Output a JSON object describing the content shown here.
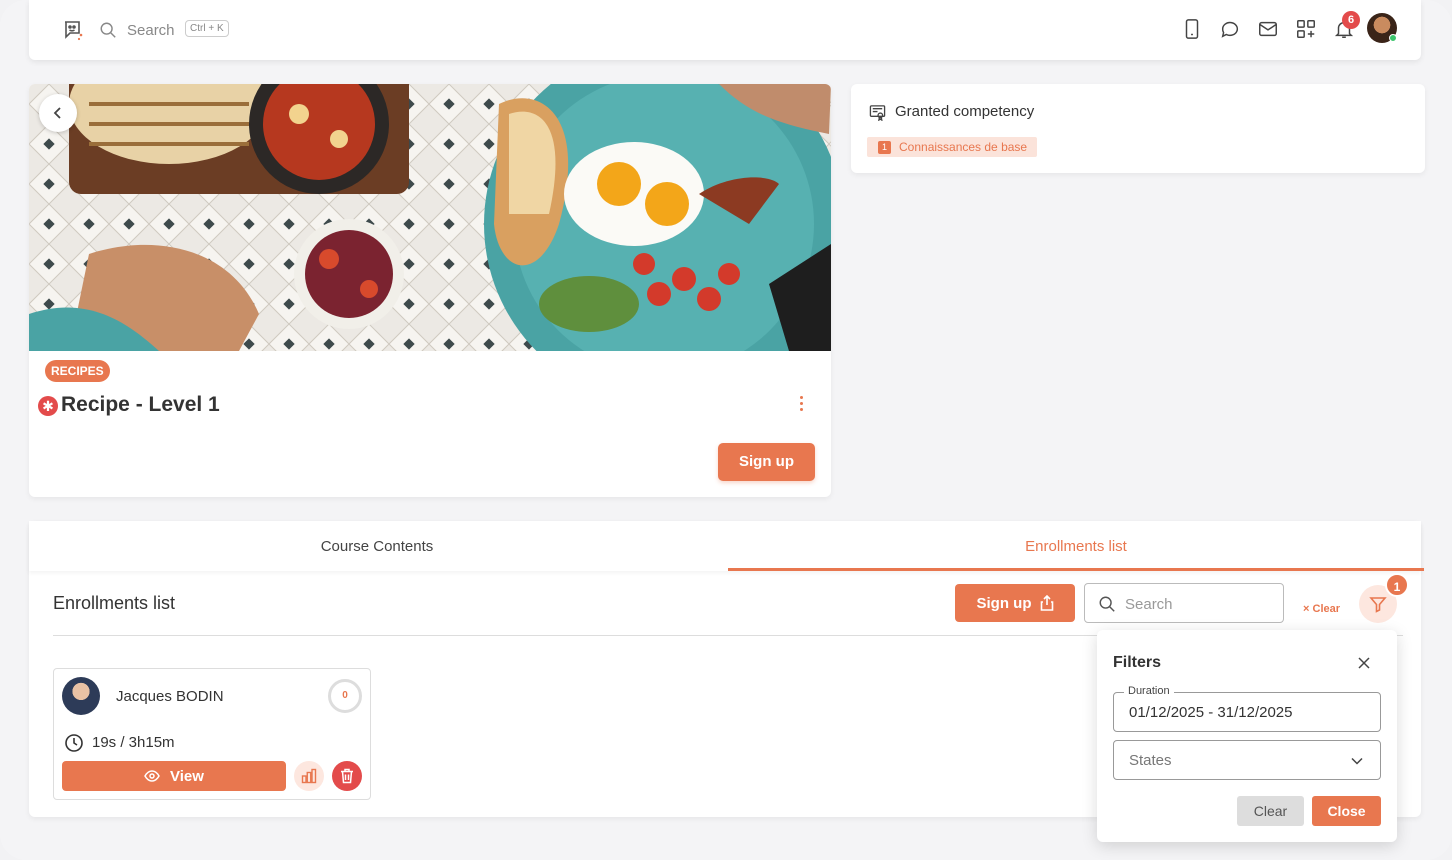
{
  "topbar": {
    "search_placeholder": "Search",
    "shortcut": "Ctrl + K",
    "notifications_count": "6",
    "icons": [
      "logo-icon",
      "search-icon",
      "mobile-icon",
      "chat-icon",
      "mail-icon",
      "apps-icon",
      "bell-icon"
    ]
  },
  "course": {
    "category": "RECIPES",
    "title": "Recipe - Level 1",
    "signup_label": "Sign up"
  },
  "competency": {
    "title": "Granted competency",
    "tag_number": "1",
    "tag_label": "Connaissances de base"
  },
  "tabs": [
    {
      "label": "Course Contents",
      "active": false
    },
    {
      "label": "Enrollments list",
      "active": true
    }
  ],
  "enrollments": {
    "title": "Enrollments list",
    "signup_label": "Sign up",
    "search_placeholder": "Search",
    "clear_label": "Clear",
    "filter_count": "1",
    "items": [
      {
        "name": "Jacques BODIN",
        "progress": "0",
        "time": "19s / 3h15m",
        "view_label": "View"
      }
    ]
  },
  "filters": {
    "title": "Filters",
    "duration_label": "Duration",
    "duration_value": "01/12/2025 - 31/12/2025",
    "states_placeholder": "States",
    "clear_label": "Clear",
    "close_label": "Close"
  },
  "colors": {
    "accent": "#e8774f",
    "danger": "#e34b4b",
    "online": "#3bc46b"
  }
}
